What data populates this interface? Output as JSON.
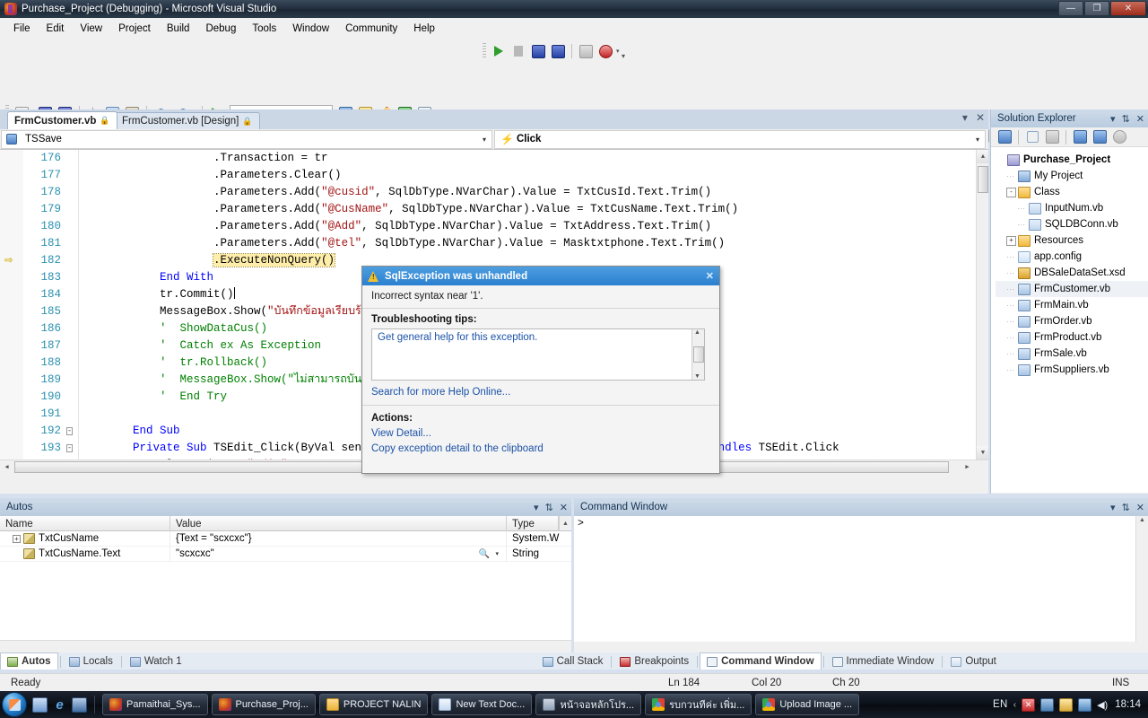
{
  "window": {
    "title": "Purchase_Project (Debugging) - Microsoft Visual Studio",
    "minimize_label": "—",
    "maximize_label": "❐",
    "close_label": "✕"
  },
  "menu": {
    "items": [
      "File",
      "Edit",
      "View",
      "Project",
      "Build",
      "Debug",
      "Tools",
      "Window",
      "Community",
      "Help"
    ]
  },
  "toolbar": {
    "standard_icons": [
      "open-file-icon",
      "save-icon",
      "save-all-icon",
      "cut-icon",
      "copy-icon",
      "paste-icon",
      "undo-icon",
      "redo-icon",
      "start-debug-icon"
    ],
    "find_combo_value": "",
    "right_icons": [
      "solution-explorer-icon",
      "properties-window-icon",
      "toolbox-icon",
      "object-browser-icon",
      "command-window-icon"
    ],
    "debug_icons": [
      "continue-icon",
      "break-all-icon",
      "stop-debug-icon",
      "restart-icon",
      "show-next-statement-icon",
      "breakpoint-icon"
    ],
    "overflow_label": "▾"
  },
  "editor": {
    "tabs": [
      {
        "label": "FrmCustomer.vb",
        "active": true,
        "locked": true
      },
      {
        "label": "FrmCustomer.vb [Design]",
        "active": false,
        "locked": true
      }
    ],
    "nav_left": "TSSave",
    "nav_right": "Click",
    "nav_arrow": "▾",
    "lines": [
      {
        "num": "176",
        "indent": 5,
        "segments": [
          {
            "t": ".Transaction = tr",
            "c": "txt"
          }
        ]
      },
      {
        "num": "177",
        "indent": 5,
        "segments": [
          {
            "t": ".Parameters.Clear()",
            "c": "txt"
          }
        ]
      },
      {
        "num": "178",
        "indent": 5,
        "segments": [
          {
            "t": ".Parameters.Add(",
            "c": "txt"
          },
          {
            "t": "\"@cusid\"",
            "c": "str"
          },
          {
            "t": ", SqlDbType.NVarChar).Value = TxtCusId.Text.Trim()",
            "c": "txt"
          }
        ]
      },
      {
        "num": "179",
        "indent": 5,
        "segments": [
          {
            "t": ".Parameters.Add(",
            "c": "txt"
          },
          {
            "t": "\"@CusName\"",
            "c": "str"
          },
          {
            "t": ", SqlDbType.NVarChar).Value = TxtCusName.Text.Trim()",
            "c": "txt"
          }
        ]
      },
      {
        "num": "180",
        "indent": 5,
        "segments": [
          {
            "t": ".Parameters.Add(",
            "c": "txt"
          },
          {
            "t": "\"@Add\"",
            "c": "str"
          },
          {
            "t": ", SqlDbType.NVarChar).Value = TxtAddress.Text.Trim()",
            "c": "txt"
          }
        ]
      },
      {
        "num": "181",
        "indent": 5,
        "segments": [
          {
            "t": ".Parameters.Add(",
            "c": "txt"
          },
          {
            "t": "\"@tel\"",
            "c": "str"
          },
          {
            "t": ", SqlDbType.NVarChar).Value = Masktxtphone.Text.Trim()",
            "c": "txt"
          }
        ]
      },
      {
        "num": "182",
        "indent": 5,
        "current": true,
        "highlight": ".ExecuteNonQuery()",
        "segments": []
      },
      {
        "num": "183",
        "indent": 3,
        "segments": [
          {
            "t": "End With",
            "c": "kw"
          }
        ]
      },
      {
        "num": "184",
        "indent": 3,
        "caret": true,
        "segments": [
          {
            "t": "tr.Commit()",
            "c": "txt"
          }
        ]
      },
      {
        "num": "185",
        "indent": 3,
        "segments": [
          {
            "t": "MessageBox.Show(",
            "c": "txt"
          },
          {
            "t": "\"บันทึกข้อมูลเรียบร้อยแล้ว\"",
            "c": "str"
          },
          {
            "t": ")",
            "c": "txt"
          }
        ]
      },
      {
        "num": "186",
        "indent": 3,
        "segments": [
          {
            "t": "'  ShowDataCus()",
            "c": "cmt"
          }
        ]
      },
      {
        "num": "187",
        "indent": 3,
        "segments": [
          {
            "t": "'  Catch ex As Exception",
            "c": "cmt"
          }
        ]
      },
      {
        "num": "188",
        "indent": 3,
        "segments": [
          {
            "t": "'  tr.Rollback()",
            "c": "cmt"
          }
        ]
      },
      {
        "num": "189",
        "indent": 3,
        "segments": [
          {
            "t": "'  MessageBox.Show(\"ไม่สามารถบันทึกข้อมูลได้\")",
            "c": "cmt"
          }
        ]
      },
      {
        "num": "190",
        "indent": 3,
        "segments": [
          {
            "t": "'  End Try",
            "c": "cmt"
          }
        ]
      },
      {
        "num": "191",
        "indent": 0,
        "segments": []
      },
      {
        "num": "192",
        "indent": 2,
        "fold": "-",
        "segments": [
          {
            "t": "End Sub",
            "c": "kw"
          }
        ]
      },
      {
        "num": "193",
        "indent": 2,
        "fold": "-",
        "segments": [
          {
            "t": "Private Sub ",
            "c": "kw"
          },
          {
            "t": "TSEdit_Click(ByVal sender As System.Object, ByVal e As System.EventArgs) ",
            "c": "txt"
          },
          {
            "t": "Handles ",
            "c": "kw"
          },
          {
            "t": "TSEdit.Click",
            "c": "txt"
          }
        ]
      },
      {
        "num": "194",
        "indent": 3,
        "segments": [
          {
            "t": "FlagAction = ",
            "c": "txt"
          },
          {
            "t": "\"Edit\"",
            "c": "str"
          }
        ]
      }
    ],
    "split_grip": "⋯"
  },
  "exception_popup": {
    "title": "SqlException was unhandled",
    "close_label": "✕",
    "message": "Incorrect syntax near '1'.",
    "tips_heading": "Troubleshooting tips:",
    "tip_link": "Get general help for this exception.",
    "search_link": "Search for more Help Online...",
    "actions_heading": "Actions:",
    "action_links": [
      "View Detail...",
      "Copy exception detail to the clipboard"
    ]
  },
  "solution_explorer": {
    "title": "Solution Explorer",
    "header_buttons": [
      "dropdown-icon",
      "pin-icon",
      "close-icon"
    ],
    "toolbar_icons": [
      "properties-icon",
      "show-all-files-icon",
      "refresh-icon",
      "view-code-icon",
      "view-designer-icon",
      "class-view-icon"
    ],
    "tree": [
      {
        "label": "Purchase_Project",
        "depth": 0,
        "icon": "solution-icon",
        "bold": true,
        "expander": ""
      },
      {
        "label": "My Project",
        "depth": 1,
        "icon": "myproject-icon",
        "expander": ""
      },
      {
        "label": "Class",
        "depth": 1,
        "icon": "folder-icon",
        "expander": "-"
      },
      {
        "label": "InputNum.vb",
        "depth": 2,
        "icon": "vb-file-icon",
        "expander": ""
      },
      {
        "label": "SQLDBConn.vb",
        "depth": 2,
        "icon": "vb-file-icon",
        "expander": ""
      },
      {
        "label": "Resources",
        "depth": 1,
        "icon": "folder-icon",
        "expander": "+"
      },
      {
        "label": "app.config",
        "depth": 1,
        "icon": "config-icon",
        "expander": ""
      },
      {
        "label": "DBSaleDataSet.xsd",
        "depth": 1,
        "icon": "dataset-icon",
        "expander": ""
      },
      {
        "label": "FrmCustomer.vb",
        "depth": 1,
        "icon": "form-icon",
        "expander": "",
        "selected": true
      },
      {
        "label": "FrmMain.vb",
        "depth": 1,
        "icon": "form-icon",
        "expander": ""
      },
      {
        "label": "FrmOrder.vb",
        "depth": 1,
        "icon": "form-icon",
        "expander": ""
      },
      {
        "label": "FrmProduct.vb",
        "depth": 1,
        "icon": "form-icon",
        "expander": ""
      },
      {
        "label": "FrmSale.vb",
        "depth": 1,
        "icon": "form-icon",
        "expander": ""
      },
      {
        "label": "FrmSuppliers.vb",
        "depth": 1,
        "icon": "form-icon",
        "expander": ""
      }
    ]
  },
  "autos_panel": {
    "title": "Autos",
    "header_buttons": [
      "dropdown-icon",
      "pin-icon",
      "close-icon"
    ],
    "columns": [
      "Name",
      "Value",
      "Type"
    ],
    "rows": [
      {
        "expander": "+",
        "name": "TxtCusName",
        "value": "{Text = \"scxcxc\"}",
        "type": "System.W",
        "magnifier": false
      },
      {
        "expander": "",
        "name": "TxtCusName.Text",
        "value": "\"scxcxc\"",
        "type": "String",
        "magnifier": true
      }
    ]
  },
  "command_panel": {
    "title": "Command Window",
    "header_buttons": [
      "dropdown-icon",
      "pin-icon",
      "close-icon"
    ],
    "prompt": ">"
  },
  "dock_tabs_left": [
    {
      "label": "Autos",
      "icon": "autos-icon",
      "active": true
    },
    {
      "label": "Locals",
      "icon": "locals-icon",
      "active": false
    },
    {
      "label": "Watch 1",
      "icon": "watch-icon",
      "active": false
    }
  ],
  "dock_tabs_right": [
    {
      "label": "Call Stack",
      "icon": "call-stack-icon",
      "active": false
    },
    {
      "label": "Breakpoints",
      "icon": "breakpoints-icon",
      "active": false
    },
    {
      "label": "Command Window",
      "icon": "command-window-icon",
      "active": true
    },
    {
      "label": "Immediate Window",
      "icon": "immediate-window-icon",
      "active": false
    },
    {
      "label": "Output",
      "icon": "output-icon",
      "active": false
    }
  ],
  "statusbar": {
    "status": "Ready",
    "line": "Ln 184",
    "col": "Col 20",
    "ch": "Ch 20",
    "insert_mode": "INS"
  },
  "taskbar": {
    "start_label": "Start",
    "quick_launch": [
      "show-desktop-icon",
      "internet-explorer-icon",
      "switch-window-icon"
    ],
    "buttons": [
      {
        "label": "Pamaithai_Sys...",
        "icon": "visual-studio-icon"
      },
      {
        "label": "Purchase_Proj...",
        "icon": "visual-studio-icon"
      },
      {
        "label": "PROJECT NALIN",
        "icon": "folder-icon"
      },
      {
        "label": "New Text Doc...",
        "icon": "text-document-icon"
      },
      {
        "label": "หน้าจอหลักโปร...",
        "icon": "image-icon"
      },
      {
        "label": "รบกวนทีค่ะ เพิ่ม...",
        "icon": "chrome-icon"
      },
      {
        "label": "Upload Image ...",
        "icon": "chrome-icon"
      }
    ],
    "language": "EN",
    "tray_icons": [
      "chevron-up-icon",
      "antivirus-icon",
      "monitor-icon",
      "notes-icon",
      "network-icon",
      "volume-icon"
    ],
    "clock": "18:14"
  }
}
